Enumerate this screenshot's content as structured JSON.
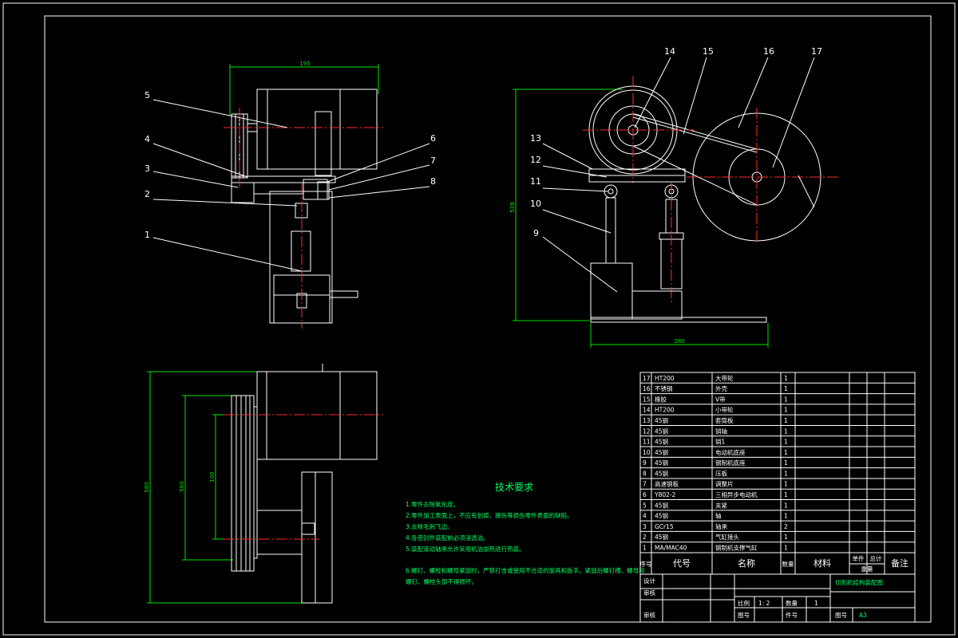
{
  "dimensions": {
    "top_width": "195",
    "right_height": "528",
    "right_width": "280",
    "bottom_height_outer": "580",
    "bottom_height_mid": "560",
    "bottom_height_inner": "100"
  },
  "balloons": [
    "1",
    "2",
    "3",
    "4",
    "5",
    "6",
    "7",
    "8",
    "9",
    "10",
    "11",
    "12",
    "13",
    "14",
    "15",
    "16",
    "17"
  ],
  "tech": {
    "title": "技术要求",
    "notes": [
      "1.零件去除氧化皮。",
      "2.零件加工表面上，不应有划痕、擦伤等损伤零件表面的缺陷。",
      "3.去除毛刺飞边。",
      "4.各密封件装配前必须浸透油。",
      "5.装配滚动轴承允许采用机油加热进行热装。",
      "6.螺钉、螺栓和螺母紧固时，严禁打击或使用不合适的旋具和扳手。紧固后螺钉槽、螺母和",
      "螺钉、螺栓头部不得损坏。"
    ]
  },
  "bom": {
    "rows": [
      {
        "no": "17",
        "code": "HT200",
        "name": "大带轮",
        "qty": "1"
      },
      {
        "no": "16",
        "code": "不锈钢",
        "name": "外壳",
        "qty": "1"
      },
      {
        "no": "15",
        "code": "橡胶",
        "name": "V带",
        "qty": "1"
      },
      {
        "no": "14",
        "code": "HT200",
        "name": "小带轮",
        "qty": "1"
      },
      {
        "no": "13",
        "code": "45钢",
        "name": "套筒板",
        "qty": "1"
      },
      {
        "no": "12",
        "code": "45钢",
        "name": "销轴",
        "qty": "1"
      },
      {
        "no": "11",
        "code": "45钢",
        "name": "销1",
        "qty": "1"
      },
      {
        "no": "10",
        "code": "45钢",
        "name": "电动机底座",
        "qty": "1"
      },
      {
        "no": "9",
        "code": "45钢",
        "name": "钢制机底座",
        "qty": "1"
      },
      {
        "no": "8",
        "code": "45钢",
        "name": "压板",
        "qty": "1"
      },
      {
        "no": "7",
        "code": "高速钢板",
        "name": "调整片",
        "qty": "1"
      },
      {
        "no": "6",
        "code": "Y802-2",
        "name": "三相异步电动机",
        "qty": "1"
      },
      {
        "no": "5",
        "code": "45钢",
        "name": "夹紧",
        "qty": "1"
      },
      {
        "no": "4",
        "code": "45钢",
        "name": "轴",
        "qty": "1"
      },
      {
        "no": "3",
        "code": "GCr15",
        "name": "轴承",
        "qty": "2"
      },
      {
        "no": "2",
        "code": "45钢",
        "name": "气缸接头",
        "qty": "1"
      },
      {
        "no": "1",
        "code": "MA/MAC40",
        "name": "钢制机支撑气缸",
        "qty": "1"
      }
    ],
    "header": {
      "no": "序号",
      "code": "代号",
      "name": "名称",
      "qty": "数量",
      "material": "材料",
      "single": "单件",
      "total": "总计",
      "weight": "重量",
      "remark": "备注"
    },
    "title_block": {
      "drawing_title": "切割机结构装配图",
      "design": "设计",
      "check": "审核",
      "approve": "审核",
      "scale_label": "比例",
      "scale_value": "1: 2",
      "qty_label": "数量",
      "qty_value": "1",
      "sheet_label": "图号",
      "sheet_value": "A3",
      "drawing_no_label": "图号",
      "part_no_label": "件号"
    }
  }
}
